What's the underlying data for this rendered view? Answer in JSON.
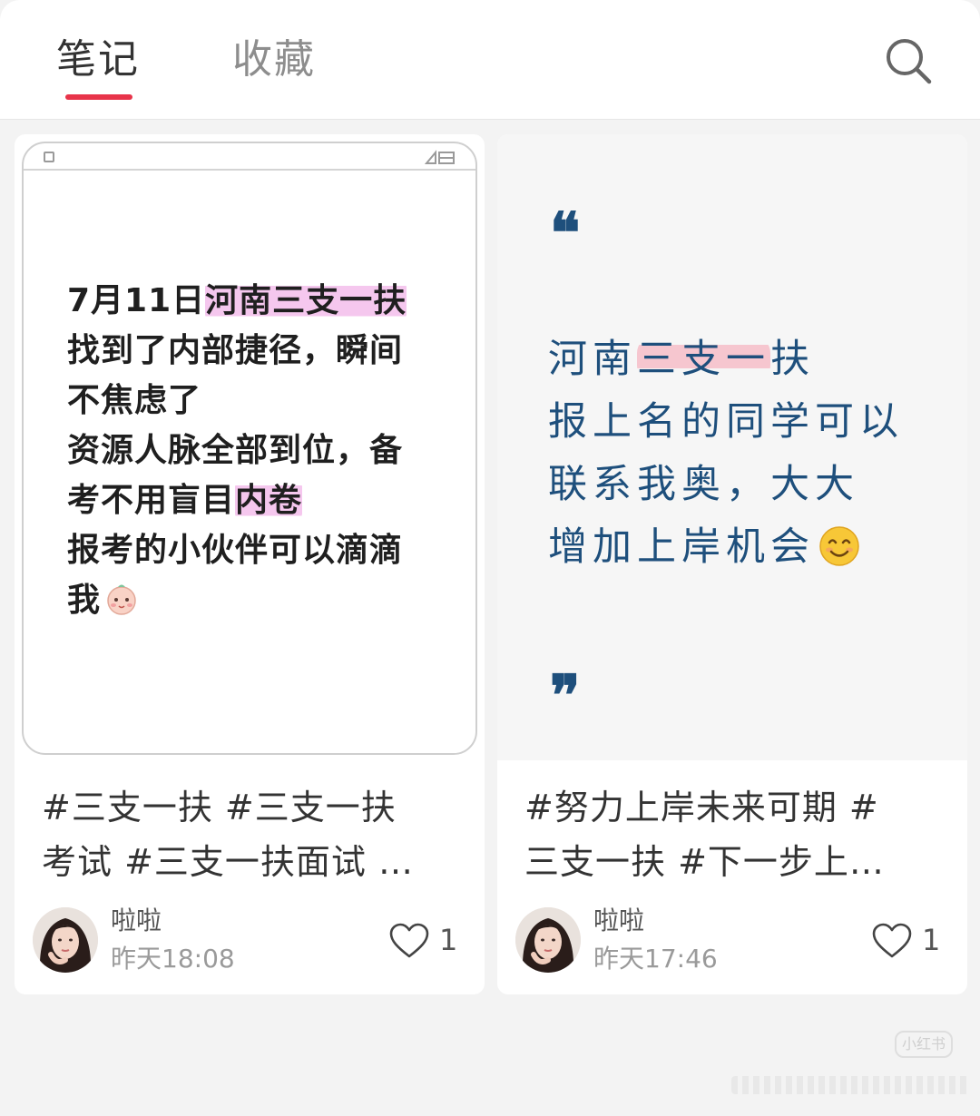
{
  "tabs": [
    {
      "label": "笔记",
      "active": true
    },
    {
      "label": "收藏",
      "active": false
    }
  ],
  "search_icon": "search-icon",
  "accent_color": "#e8344a",
  "cards": [
    {
      "cover": {
        "lines": [
          {
            "pre": "7月11日",
            "hl": "河南三支一扶",
            "post": ""
          },
          {
            "pre": "找到了内部捷径，瞬间",
            "hl": "",
            "post": ""
          },
          {
            "pre": "不焦虑了",
            "hl": "",
            "post": ""
          },
          {
            "pre": "资源人脉全部到位，备",
            "hl": "",
            "post": ""
          },
          {
            "pre": "考不用盲目",
            "hl": "内卷",
            "post": ""
          },
          {
            "pre": "报考的小伙伴可以滴滴",
            "hl": "",
            "post": ""
          },
          {
            "pre": "我",
            "hl": "",
            "post": ""
          }
        ],
        "emoji": "baby-face-icon"
      },
      "caption_lines": [
        "#三支一扶 #三支一扶",
        "考试 #三支一扶面试 …"
      ],
      "author": "啦啦",
      "time": "昨天18:08",
      "likes": "1"
    },
    {
      "cover": {
        "quote_open": "❝",
        "lines": [
          {
            "pre": "河南",
            "hl": "三支一",
            "post": "扶"
          },
          {
            "pre": "报上名的同学可以",
            "hl": "",
            "post": ""
          },
          {
            "pre": "联系我奥，大大",
            "hl": "",
            "post": ""
          },
          {
            "pre": "增加上岸机会",
            "hl": "",
            "post": ""
          }
        ],
        "quote_close": "❞",
        "emoji": "smiling-face-icon"
      },
      "caption_lines": [
        "#努力上岸未来可期 #",
        "三支一扶 #下一步上…"
      ],
      "author": "啦啦",
      "time": "昨天17:46",
      "likes": "1"
    }
  ],
  "watermark": "小红书"
}
